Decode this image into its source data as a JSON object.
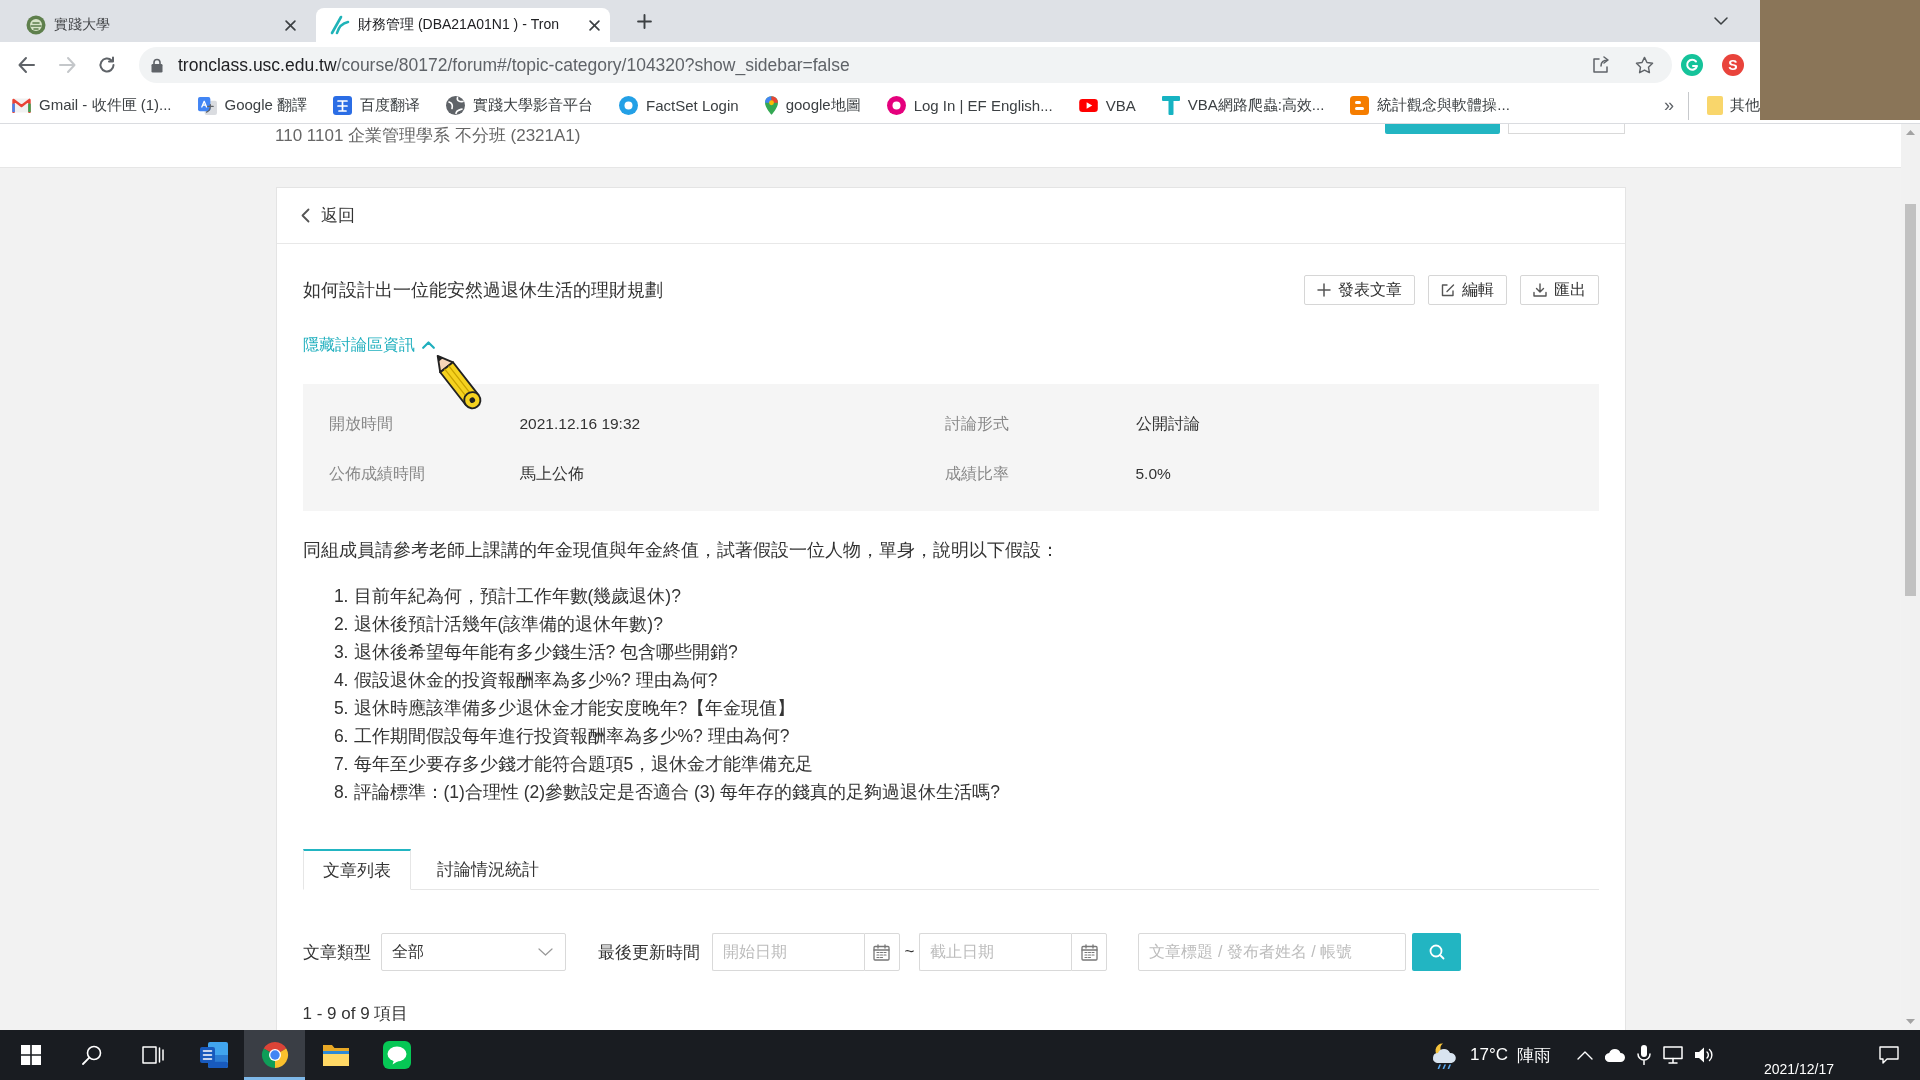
{
  "browser": {
    "tabs": [
      {
        "kind": "school",
        "title": "實踐大學",
        "selected": false
      },
      {
        "kind": "tronclass",
        "title": "財務管理 (DBA21A01N1 ) - Tron",
        "selected": true
      }
    ],
    "nav": [
      {
        "kind": "back",
        "disabled": false
      },
      {
        "kind": "forward",
        "disabled": true
      },
      {
        "kind": "reload",
        "disabled": false
      }
    ],
    "address": {
      "host": "tronclass.usc.edu.tw",
      "path": "/course/80172/forum#/topic-category/104320?show_sidebar=false"
    },
    "extensions": [
      {
        "kind": "grammar"
      },
      {
        "kind": "letter",
        "label": "S"
      }
    ],
    "bookmarks": [
      {
        "kind": "gmail",
        "label": "Gmail - 收件匣 (1)..."
      },
      {
        "kind": "google-translate",
        "label": "Google 翻譯"
      },
      {
        "kind": "baidu-translate",
        "label": "百度翻译"
      },
      {
        "kind": "globe",
        "label": "實踐大學影音平台"
      },
      {
        "kind": "factset",
        "label": "FactSet Login"
      },
      {
        "kind": "maps",
        "label": "google地圖"
      },
      {
        "kind": "ef",
        "label": "Log In | EF English..."
      },
      {
        "kind": "youtube",
        "label": "VBA"
      },
      {
        "kind": "t-logo",
        "label": "VBA網路爬蟲:高效..."
      },
      {
        "kind": "blogger",
        "label": "統計觀念與軟體操..."
      }
    ],
    "bookmarks_more": "»",
    "other_bookmarks": "其他"
  },
  "page": {
    "course": "110 1101 企業管理學系 不分班 (2321A1)",
    "back": "返回",
    "topic_title": "如何設計出一位能安然過退休生活的理財規劃",
    "actions": [
      {
        "kind": "add",
        "label": "發表文章"
      },
      {
        "kind": "edit",
        "label": "編輯"
      },
      {
        "kind": "export",
        "label": "匯出"
      }
    ],
    "info_toggle": {
      "label": "隱藏討論區資訊",
      "expanded": true
    },
    "info": [
      {
        "label": "開放時間",
        "value": "2021.12.16 19:32"
      },
      {
        "label": "討論形式",
        "value": "公開討論"
      },
      {
        "label": "公佈成績時間",
        "value": "馬上公佈"
      },
      {
        "label": "成績比率",
        "value": "5.0%"
      }
    ],
    "description": "同組成員請參考老師上課講的年金現值與年金終值，試著假設一位人物，單身，說明以下假設：",
    "questions": [
      {
        "number": "1.",
        "text": "目前年紀為何，預計工作年數(幾歲退休)?"
      },
      {
        "number": "2.",
        "text": "退休後預計活幾年(該準備的退休年數)?"
      },
      {
        "number": "3.",
        "text": "退休後希望每年能有多少錢生活? 包含哪些開銷?"
      },
      {
        "number": "4.",
        "text": "假設退休金的投資報酬率為多少%? 理由為何?"
      },
      {
        "number": "5.",
        "text": "退休時應該準備多少退休金才能安度晚年?【年金現值】"
      },
      {
        "number": "6.",
        "text": "工作期間假設每年進行投資報酬率為多少%? 理由為何?"
      },
      {
        "number": "7.",
        "text": "每年至少要存多少錢才能符合題項5，退休金才能準備充足"
      },
      {
        "number": "8.",
        "text": "評論標準：(1)合理性 (2)參數設定是否適合 (3) 每年存的錢真的足夠過退休生活嗎?"
      }
    ],
    "tabs": [
      {
        "label": "文章列表",
        "selected": true
      },
      {
        "label": "討論情況統計",
        "selected": false
      }
    ],
    "filters": {
      "type_label": "文章類型",
      "type_value": "全部",
      "time_label": "最後更新時間",
      "start_placeholder": "開始日期",
      "separator": "~",
      "end_placeholder": "截止日期",
      "search_placeholder": "文章標題 / 發布者姓名 / 帳號"
    },
    "count": "1 - 9 of 9 項目"
  },
  "taskbar": {
    "apps": [
      {
        "kind": "start",
        "active": false
      },
      {
        "kind": "search",
        "active": false
      },
      {
        "kind": "task-view",
        "active": false
      },
      {
        "kind": "word",
        "active": false
      },
      {
        "kind": "chrome",
        "active": true
      },
      {
        "kind": "explorer",
        "active": false
      },
      {
        "kind": "line",
        "active": false
      }
    ],
    "weather": {
      "temperature": "17°C",
      "condition": "陣雨"
    },
    "tray": [
      {
        "kind": "chevron"
      },
      {
        "kind": "cloud"
      },
      {
        "kind": "mic"
      },
      {
        "kind": "network"
      },
      {
        "kind": "speaker"
      }
    ],
    "date": "2021/12/17"
  }
}
